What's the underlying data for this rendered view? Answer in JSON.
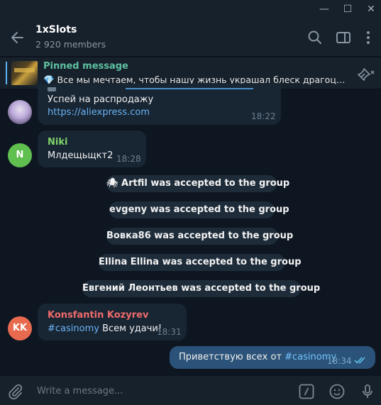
{
  "window": {
    "minimize": "—",
    "maximize": "☐",
    "close": "✕"
  },
  "header": {
    "title": "1xSlots",
    "subtitle": "2 920 members"
  },
  "pinned": {
    "title": "Pinned message",
    "text": "💎 Все мы мечтаем, чтобы нашу жизнь украшал блеск драгоцен..."
  },
  "messages": [
    {
      "text_line1": "Успей на распродажу",
      "link": "https://aliexpress.com",
      "time": "18:22"
    },
    {
      "sender": "Niki",
      "avatar": "N",
      "text": "Млдещьщкт2",
      "time": "18:28"
    }
  ],
  "service": [
    "🕷 Artfil was accepted to the group",
    "evgeny was accepted to the group",
    "Вовка86 was accepted to the group",
    "Ellina Ellina was accepted to the group",
    "Евгений Леонтьев was accepted to the group"
  ],
  "konst": {
    "sender": "Konsfantin Kozyrev",
    "avatar": "KK",
    "hashtag": "#casinomy",
    "text": " Всем удачи!",
    "time": "18:31"
  },
  "own": {
    "text": "Приветствую всех от ",
    "hashtag": "#casinomy",
    "time": "18:34"
  },
  "composer": {
    "placeholder": "Write a message..."
  },
  "colors": {
    "background": "#0e1621",
    "panel": "#17212b",
    "bubble_in": "#182533",
    "bubble_out": "#2b5278",
    "accent": "#6ab3f3"
  }
}
